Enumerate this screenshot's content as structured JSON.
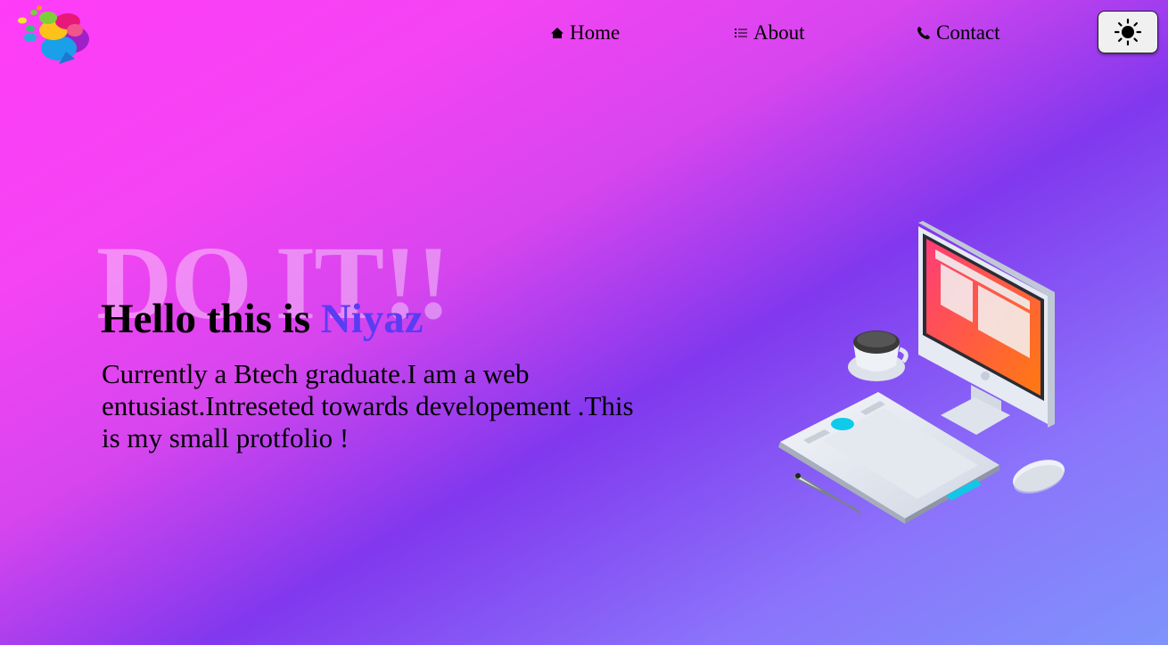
{
  "nav": {
    "home_label": "Home",
    "about_label": "About",
    "contact_label": "Contact"
  },
  "hero": {
    "watermark": "DO IT!!",
    "greeting": "Hello this is",
    "name": "Niyaz",
    "description": "Currently a Btech graduate.I am a web entusiast.Intreseted towards developement .This is my small protfolio !"
  },
  "icons": {
    "logo": "colorful-head-logo-icon",
    "home": "home-icon",
    "about": "list-icon",
    "contact": "phone-icon",
    "theme": "sun-icon",
    "illustration": "workspace-illustration"
  },
  "colors": {
    "accent_name": "#5a3cf3",
    "bg_start": "#ff3cf8",
    "bg_mid": "#8138ee",
    "bg_end": "#7f93fb"
  }
}
